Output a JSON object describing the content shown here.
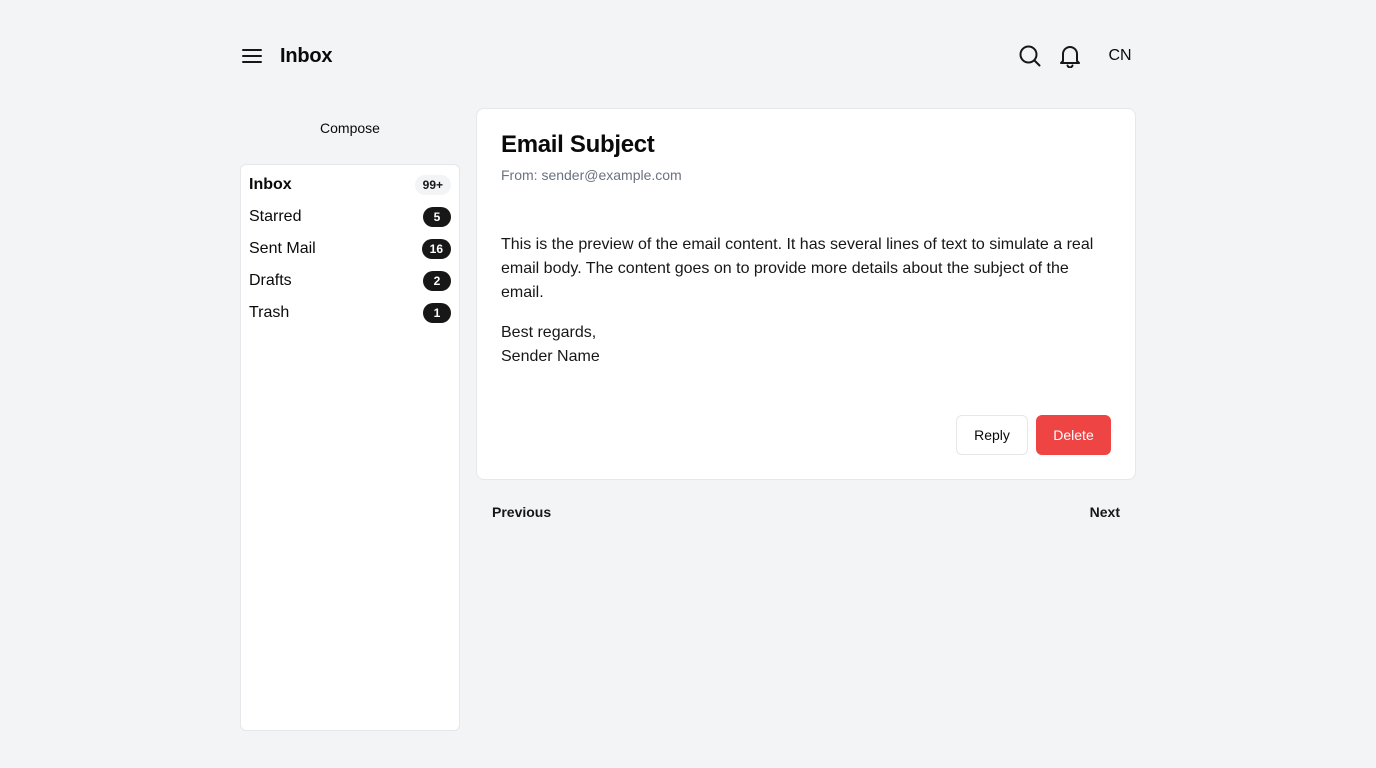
{
  "header": {
    "title": "Inbox",
    "avatar_initials": "CN",
    "icons": {
      "menu": "hamburger-menu-icon",
      "search": "search-icon",
      "notifications": "bell-icon"
    }
  },
  "sidebar": {
    "compose_label": "Compose",
    "folders": [
      {
        "label": "Inbox",
        "count": "99+",
        "active": true
      },
      {
        "label": "Starred",
        "count": "5"
      },
      {
        "label": "Sent Mail",
        "count": "16"
      },
      {
        "label": "Drafts",
        "count": "2"
      },
      {
        "label": "Trash",
        "count": "1"
      }
    ]
  },
  "email": {
    "subject": "Email Subject",
    "from": "From: sender@example.com",
    "body": "This is the preview of the email content. It has several lines of text to simulate a real email body. The content goes on to provide more details about the subject of the email.",
    "signoff_line1": "Best regards,",
    "signoff_line2": "Sender Name",
    "reply_label": "Reply",
    "delete_label": "Delete"
  },
  "pager": {
    "previous_label": "Previous",
    "next_label": "Next"
  },
  "colors": {
    "danger": "#ef4444",
    "badge": "#171717",
    "background": "#f3f4f6"
  }
}
